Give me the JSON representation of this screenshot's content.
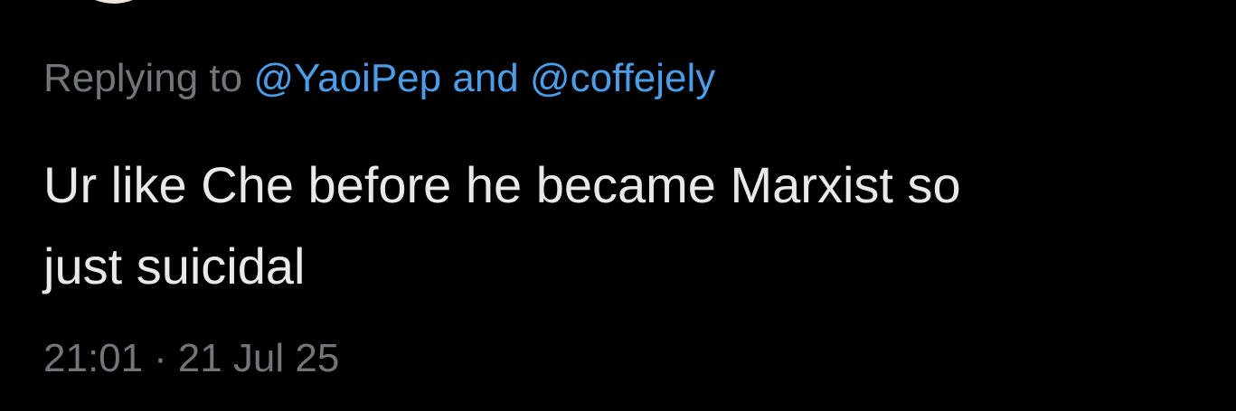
{
  "tweet": {
    "reply_prefix": "Replying to ",
    "mentions": [
      "@YaoiPep",
      "@coffejely"
    ],
    "mention_joiner": " and ",
    "text": "Ur like Che before he became Marxist so\njust suicidal",
    "time": "21:01",
    "separator": "·",
    "date": "21 Jul 25"
  },
  "colors": {
    "background": "#000000",
    "text": "#e7e9ea",
    "muted": "#71767b",
    "link": "#4a9de6"
  }
}
